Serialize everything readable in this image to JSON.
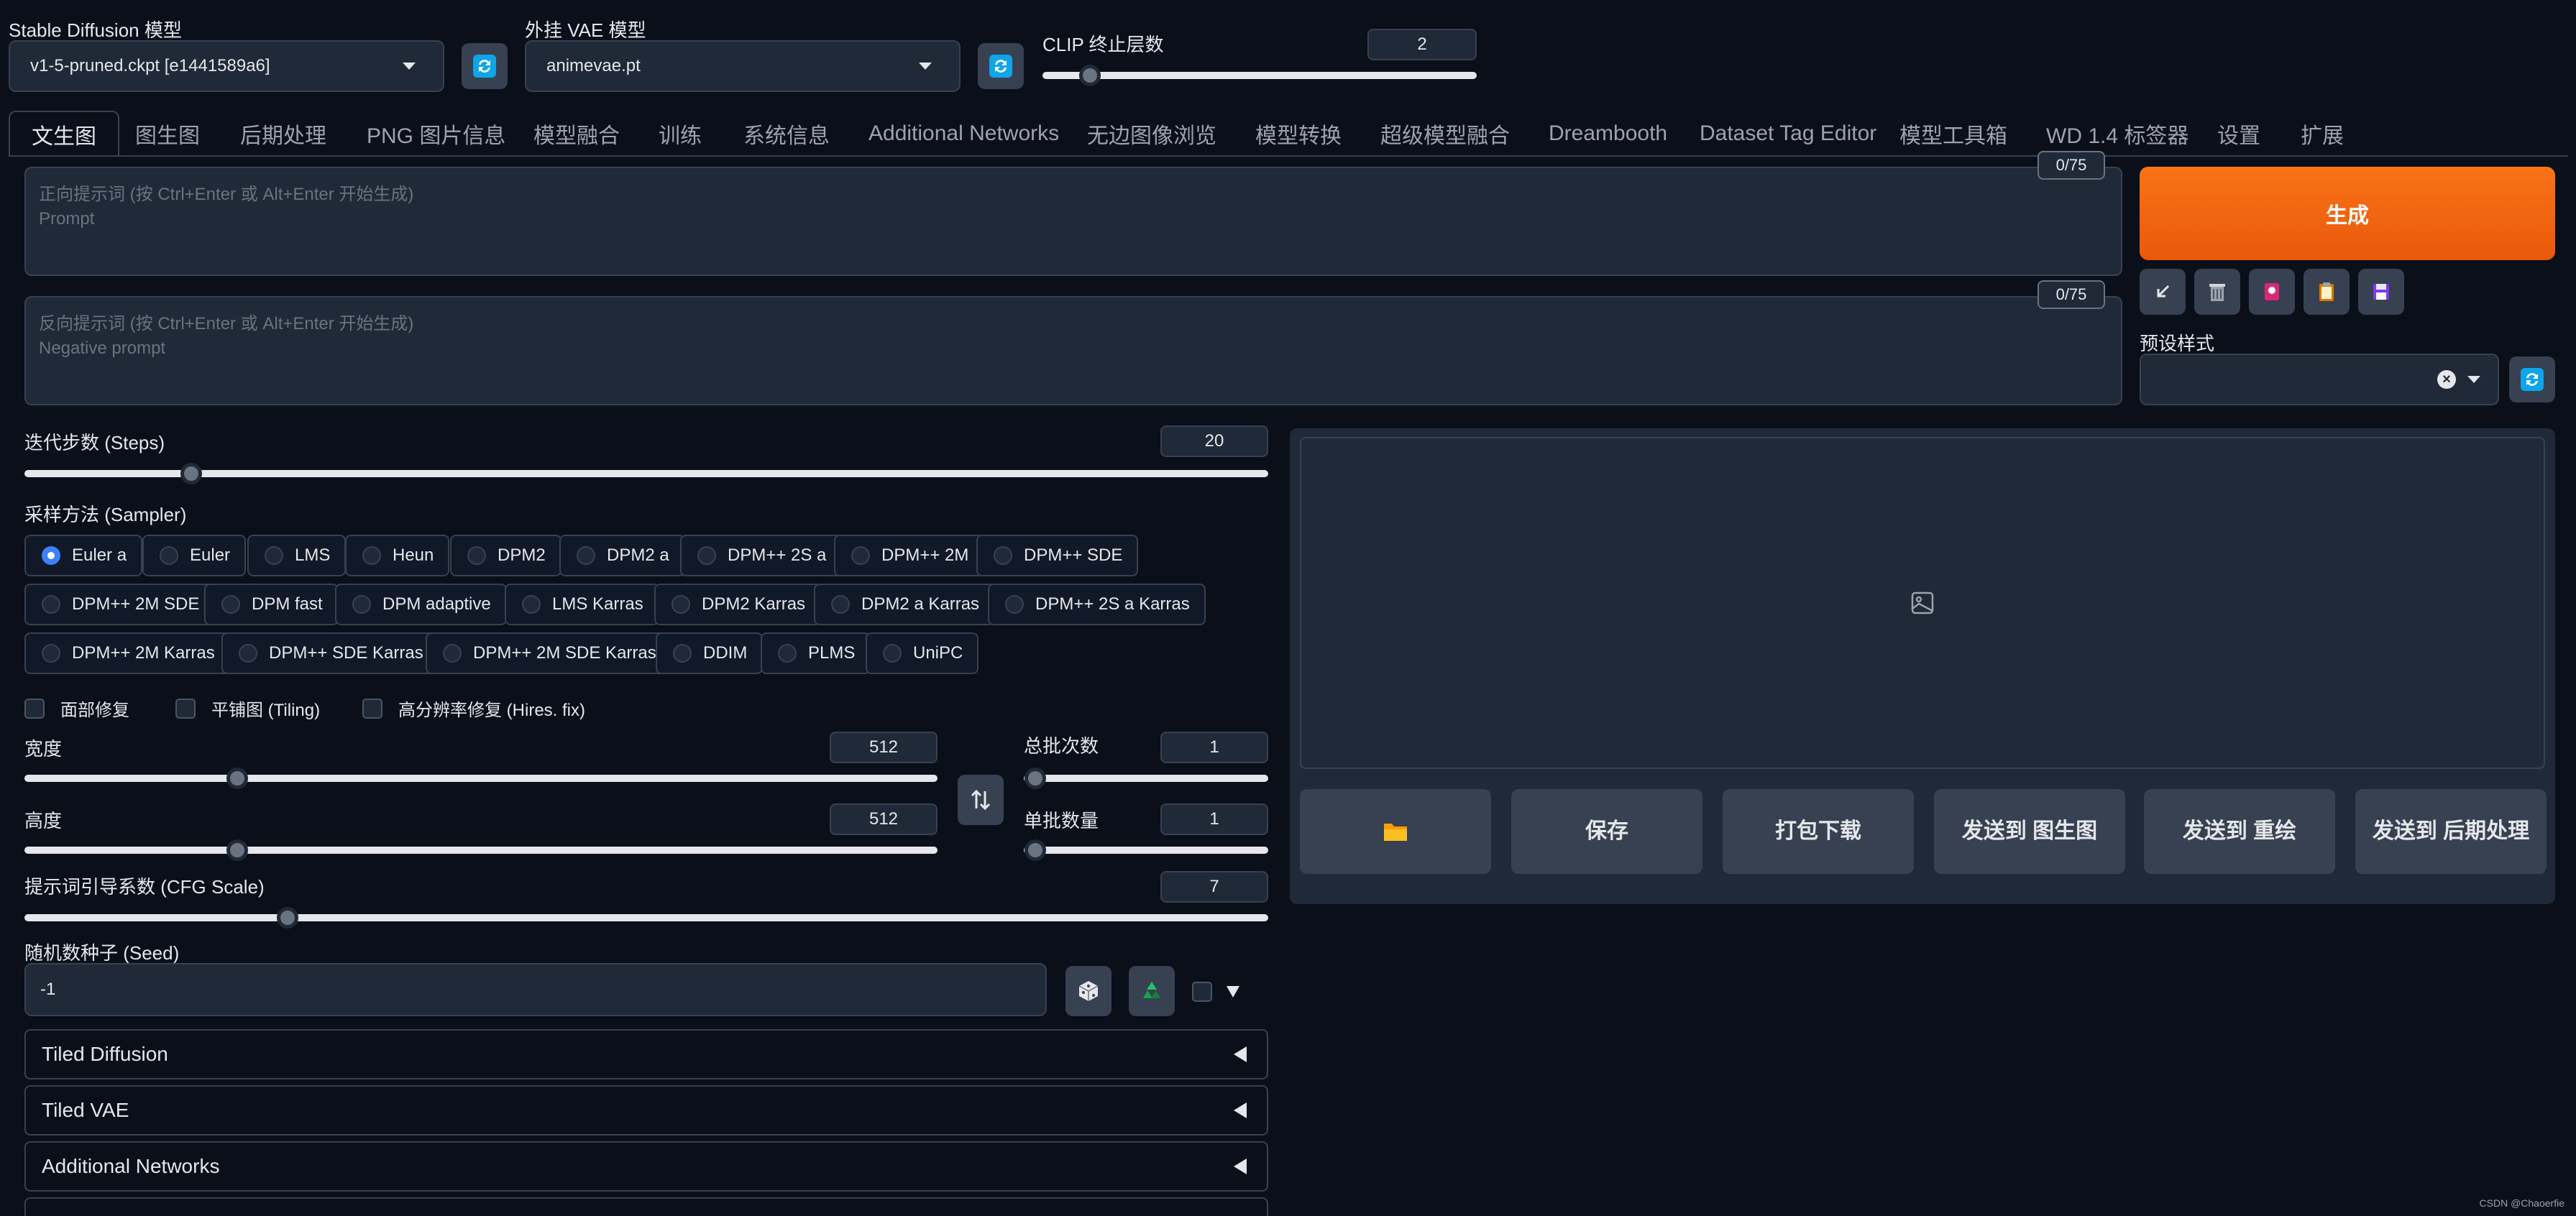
{
  "header": {
    "sd_model_label": "Stable Diffusion 模型",
    "sd_model_value": "v1-5-pruned.ckpt [e1441589a6]",
    "vae_label": "外挂 VAE 模型",
    "vae_value": "animevae.pt",
    "clip_label": "CLIP 终止层数",
    "clip_value": "2"
  },
  "tabs": [
    {
      "label": "文生图",
      "active": true
    },
    {
      "label": "图生图"
    },
    {
      "label": "后期处理"
    },
    {
      "label": "PNG 图片信息"
    },
    {
      "label": "模型融合"
    },
    {
      "label": "训练"
    },
    {
      "label": "系统信息"
    },
    {
      "label": "Additional Networks"
    },
    {
      "label": "无边图像浏览"
    },
    {
      "label": "模型转换"
    },
    {
      "label": "超级模型融合"
    },
    {
      "label": "Dreambooth"
    },
    {
      "label": "Dataset Tag Editor"
    },
    {
      "label": "模型工具箱"
    },
    {
      "label": "WD 1.4 标签器"
    },
    {
      "label": "设置"
    },
    {
      "label": "扩展"
    }
  ],
  "prompt": {
    "placeholder_line1": "正向提示词 (按 Ctrl+Enter 或 Alt+Enter 开始生成)",
    "placeholder_line2": "Prompt",
    "counter": "0/75"
  },
  "negative_prompt": {
    "placeholder_line1": "反向提示词 (按 Ctrl+Enter 或 Alt+Enter 开始生成)",
    "placeholder_line2": "Negative prompt",
    "counter": "0/75"
  },
  "generate_label": "生成",
  "styles_label": "预设样式",
  "steps": {
    "label": "迭代步数 (Steps)",
    "value": "20",
    "fraction": 0.135
  },
  "sampler": {
    "label": "采样方法 (Sampler)",
    "selected": "Euler a",
    "options": [
      "Euler a",
      "Euler",
      "LMS",
      "Heun",
      "DPM2",
      "DPM2 a",
      "DPM++ 2S a",
      "DPM++ 2M",
      "DPM++ SDE",
      "DPM++ 2M SDE",
      "DPM fast",
      "DPM adaptive",
      "LMS Karras",
      "DPM2 Karras",
      "DPM2 a Karras",
      "DPM++ 2S a Karras",
      "DPM++ 2M Karras",
      "DPM++ SDE Karras",
      "DPM++ 2M SDE Karras",
      "DDIM",
      "PLMS",
      "UniPC"
    ]
  },
  "checkboxes": {
    "face_restore": "面部修复",
    "tiling": "平铺图 (Tiling)",
    "hires_fix": "高分辨率修复 (Hires. fix)"
  },
  "width": {
    "label": "宽度",
    "value": "512",
    "fraction": 0.233
  },
  "height": {
    "label": "高度",
    "value": "512",
    "fraction": 0.233
  },
  "batch_count": {
    "label": "总批次数",
    "value": "1",
    "fraction": 0.0
  },
  "batch_size": {
    "label": "单批数量",
    "value": "1",
    "fraction": 0.0
  },
  "cfg": {
    "label": "提示词引导系数 (CFG Scale)",
    "value": "7",
    "fraction": 0.211
  },
  "seed": {
    "label": "随机数种子 (Seed)",
    "value": "-1"
  },
  "accordions": [
    "Tiled Diffusion",
    "Tiled VAE",
    "Additional Networks"
  ],
  "output_buttons": {
    "save": "保存",
    "zip": "打包下载",
    "send_img2img": "发送到 图生图",
    "send_inpaint": "发送到 重绘",
    "send_extras": "发送到 后期处理"
  },
  "watermark": "CSDN @Chaoerfie",
  "colors": {
    "accent_orange": "#f97316",
    "background": "#0b0f19",
    "panel": "#1f2937",
    "radio_selected": "#3b82f6"
  }
}
